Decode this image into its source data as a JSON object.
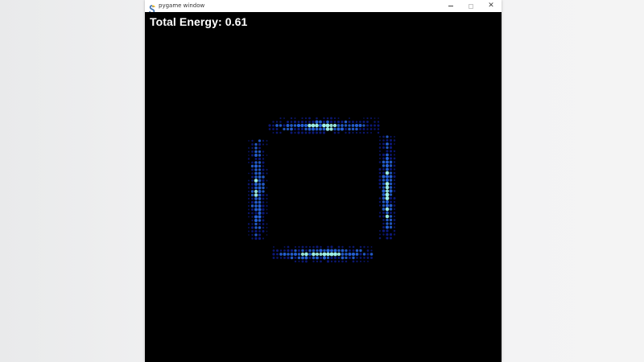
{
  "window": {
    "title": "pygame window",
    "app_icon": "pygame-snake-icon",
    "controls": {
      "minimize_icon": "minimize-icon",
      "maximize_icon": "maximize-icon",
      "close_icon": "close-icon"
    }
  },
  "hud": {
    "energy_text": "Total Energy: 0.61"
  },
  "colors": {
    "background": "#000000",
    "hud_text": "#ffffff",
    "particle_low": "#1020a0",
    "particle_mid": "#2a6cf0",
    "particle_high": "#9ff0e8"
  }
}
